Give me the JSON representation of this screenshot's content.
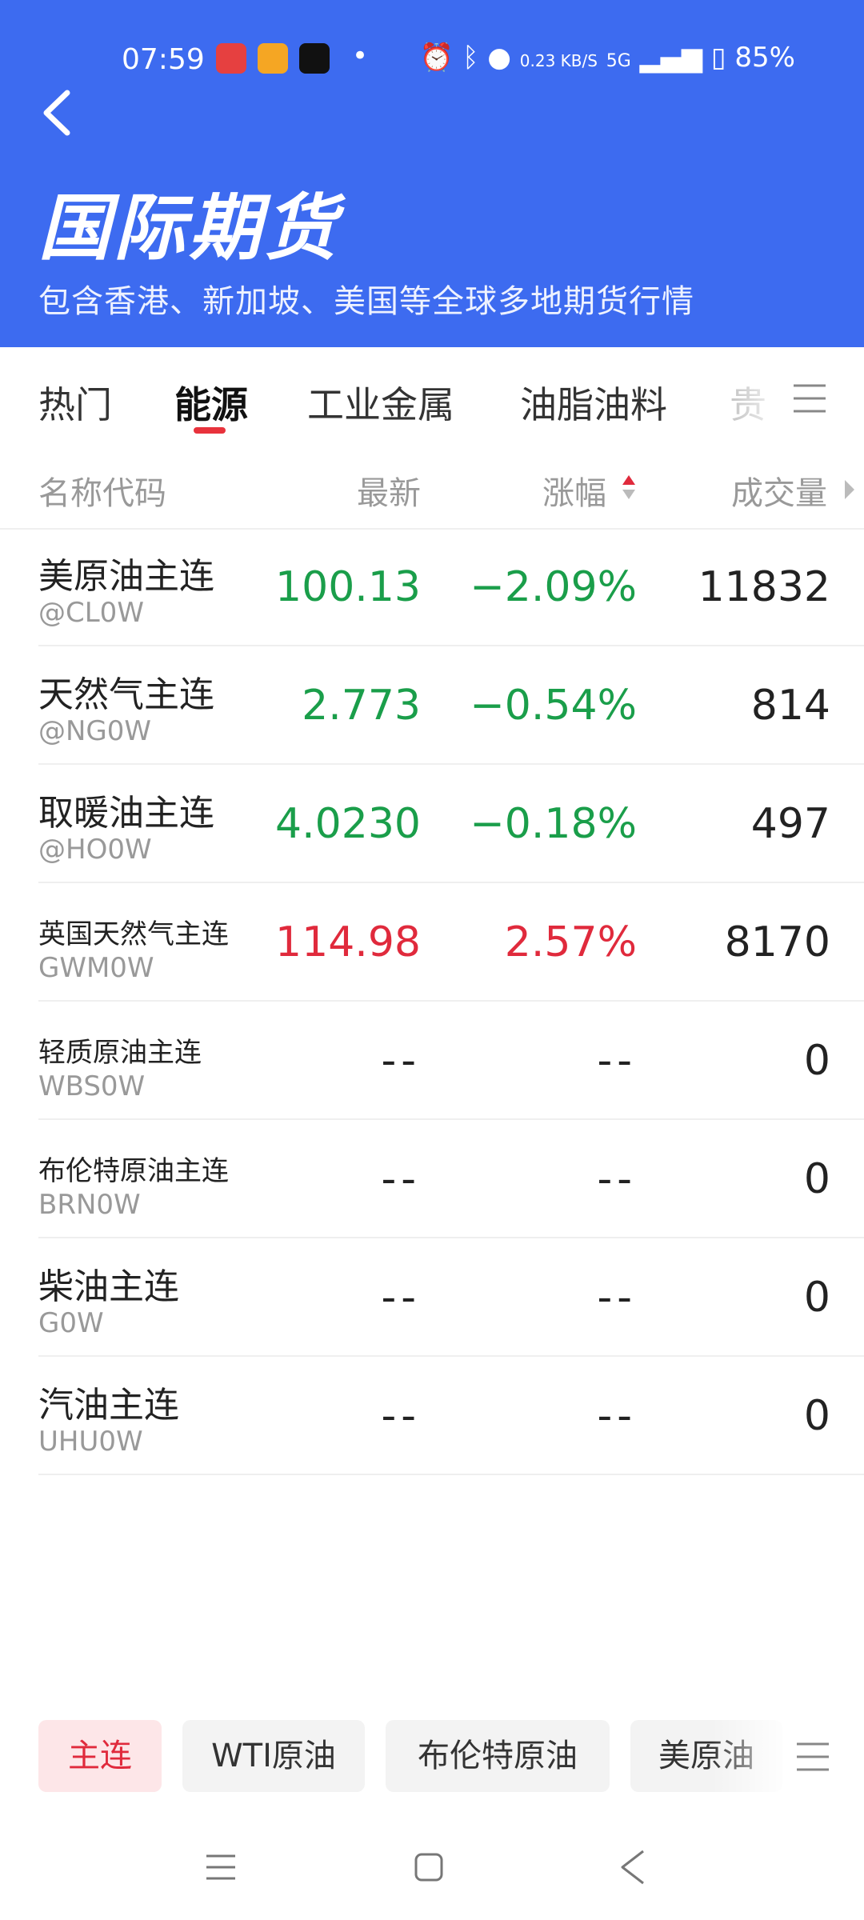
{
  "status_bar": {
    "time": "07:59",
    "network_speed": "0.23 KB/S",
    "signal": "5G",
    "battery": "85%"
  },
  "header": {
    "title": "国际期货",
    "subtitle": "包含香港、新加坡、美国等全球多地期货行情"
  },
  "tabs": [
    {
      "label": "热门"
    },
    {
      "label": "能源"
    },
    {
      "label": "工业金属"
    },
    {
      "label": "油脂油料"
    },
    {
      "label": "贵"
    }
  ],
  "columns": {
    "name": "名称代码",
    "last": "最新",
    "change": "涨幅",
    "volume": "成交量"
  },
  "rows": [
    {
      "name": "美原油主连",
      "code": "@CL0W",
      "last": "100.13",
      "change": "−2.09%",
      "volume": "11832",
      "trend": "down"
    },
    {
      "name": "天然气主连",
      "code": "@NG0W",
      "last": "2.773",
      "change": "−0.54%",
      "volume": "814",
      "trend": "down"
    },
    {
      "name": "取暖油主连",
      "code": "@HO0W",
      "last": "4.0230",
      "change": "−0.18%",
      "volume": "497",
      "trend": "down"
    },
    {
      "name": "英国天然气主连",
      "code": "GWM0W",
      "last": "114.98",
      "change": "2.57%",
      "volume": "8170",
      "trend": "up"
    },
    {
      "name": "轻质原油主连",
      "code": "WBS0W",
      "last": "--",
      "change": "--",
      "volume": "0",
      "trend": "flat"
    },
    {
      "name": "布伦特原油主连",
      "code": "BRN0W",
      "last": "--",
      "change": "--",
      "volume": "0",
      "trend": "flat"
    },
    {
      "name": "柴油主连",
      "code": "G0W",
      "last": "--",
      "change": "--",
      "volume": "0",
      "trend": "flat"
    },
    {
      "name": "汽油主连",
      "code": "UHU0W",
      "last": "--",
      "change": "--",
      "volume": "0",
      "trend": "flat"
    }
  ],
  "bottom_chips": [
    {
      "label": "主连"
    },
    {
      "label": "WTI原油"
    },
    {
      "label": "布伦特原油"
    },
    {
      "label": "美原油"
    }
  ],
  "colors": {
    "header_bg": "#3d6bf0",
    "up": "#e02a3c",
    "down": "#1a9e4a"
  }
}
